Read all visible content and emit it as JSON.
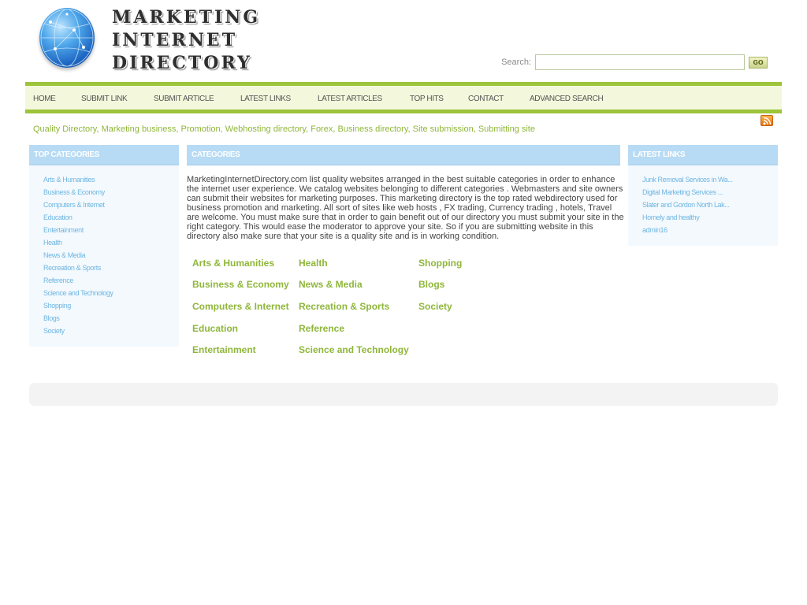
{
  "header": {
    "logo_lines": [
      "MARKETING",
      "INTERNET",
      "DIRECTORY"
    ],
    "search_label": "Search:",
    "search_value": "",
    "search_button": "GO"
  },
  "nav": [
    "HOME",
    "SUBMIT LINK",
    "SUBMIT ARTICLE",
    "LATEST LINKS",
    "LATEST ARTICLES",
    "TOP HITS",
    "CONTACT",
    "ADVANCED SEARCH"
  ],
  "tags": [
    "Quality Directory",
    "Marketing business",
    "Promotion",
    "Webhosting directory",
    "Forex",
    "Business directory",
    "Site submission",
    "Submitting site"
  ],
  "top_categories": {
    "title": "TOP CATEGORIES",
    "items": [
      "Arts & Humanities",
      "Business & Economy",
      "Computers & Internet",
      "Education",
      "Entertainment",
      "Health",
      "News & Media",
      "Recreation & Sports",
      "Reference",
      "Science and Technology",
      "Shopping",
      "Blogs",
      "Society"
    ]
  },
  "categories": {
    "title": "CATEGORIES",
    "intro": "MarketingInternetDirectory.com list quality websites arranged in the best suitable categories in order to enhance the internet user experience. We catalog websites belonging to different categories . Webmasters and site owners can submit their websites for marketing purposes. This marketing directory is the top rated webdirectory used for business promotion and marketing. All sort of sites like web hosts , FX trading, Currency trading , hotels, Travel are welcome. You must make sure that in order to gain benefit out of our directory you must submit your site in the right category. This would ease the moderator to approve your site. So if you are submitting website in this directory also make sure that your site is a quality site and is in working condition.",
    "col1": [
      "Arts & Humanities",
      "Business & Economy",
      "Computers & Internet",
      "Education",
      "Entertainment"
    ],
    "col2": [
      "Health",
      "News & Media",
      "Recreation & Sports",
      "Reference",
      "Science and Technology"
    ],
    "col3": [
      "Shopping",
      "Blogs",
      "Society"
    ]
  },
  "latest_links": {
    "title": "LATEST LINKS",
    "items": [
      "Junk Removal Services in Wa...",
      "Digital Marketing Services ...",
      "Slater and Gordon North Lak...",
      "Homely and healthy",
      "admin16"
    ]
  },
  "colors": {
    "nav_border": "#9dc43a",
    "link_green": "#8fb63a",
    "link_blue": "#6fb6e2",
    "panel_header": "#b7dbf4"
  }
}
